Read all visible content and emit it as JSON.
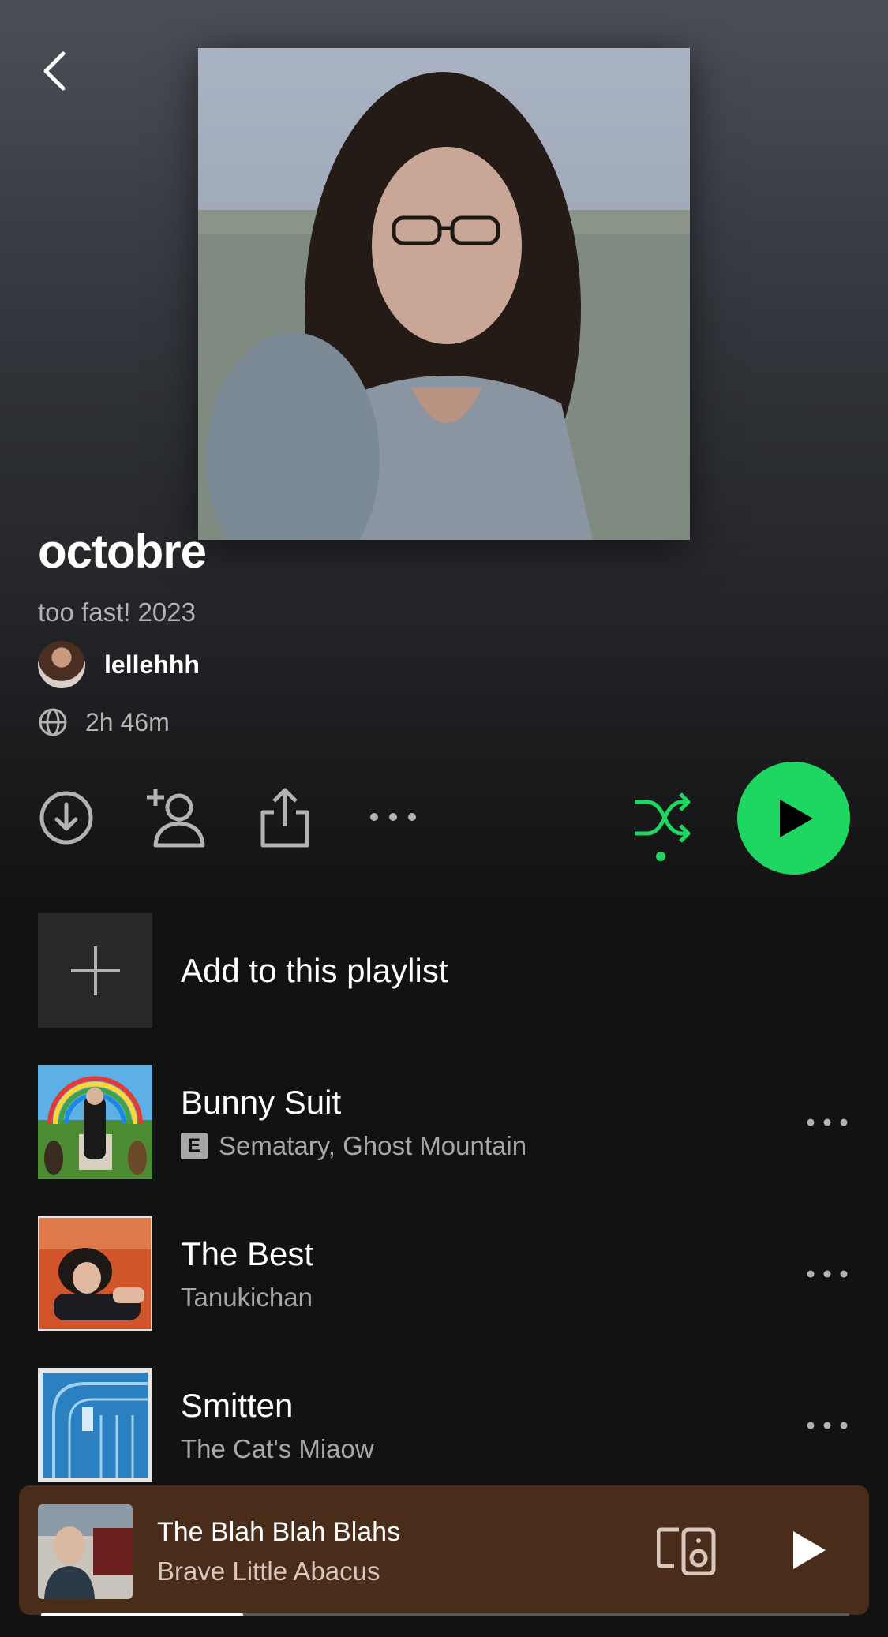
{
  "playlist": {
    "title": "octobre",
    "description": "too fast! 2023",
    "owner": "lellehhh",
    "duration": "2h 46m"
  },
  "actions": {
    "download_icon": "download-circle-icon",
    "add_user_icon": "add-user-icon",
    "share_icon": "share-icon",
    "more_icon": "more-horizontal-icon",
    "shuffle_icon": "shuffle-icon",
    "play_icon": "play-icon"
  },
  "add_row": {
    "label": "Add to this playlist"
  },
  "tracks": [
    {
      "title": "Bunny Suit",
      "artist": "Sematary, Ghost Mountain",
      "explicit_badge": "E"
    },
    {
      "title": "The Best",
      "artist": "Tanukichan"
    },
    {
      "title": "Smitten",
      "artist": "The Cat's Miaow"
    }
  ],
  "now_playing": {
    "title": "The Blah Blah Blahs",
    "artist": "Brave Little Abacus",
    "progress": 0.25
  },
  "colors": {
    "accent": "#1ed760",
    "background": "#121212",
    "mini_player": "#4a2c1b"
  }
}
